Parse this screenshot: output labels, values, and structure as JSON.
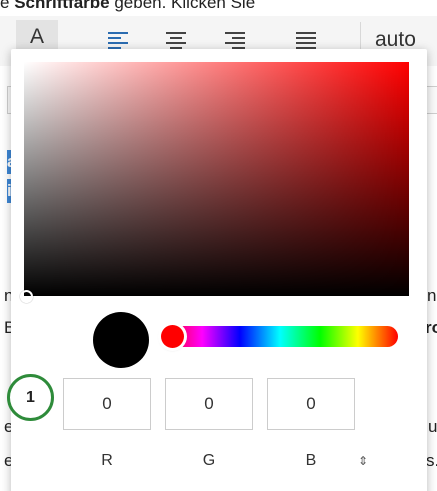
{
  "instruction": {
    "prefix": "e ",
    "bold": "Schriftfarbe",
    "suffix": " geben. Klicken Sie"
  },
  "toolbar": {
    "font_color_glyph": "A",
    "font_size_value": "auto"
  },
  "background_fragments": {
    "sel1": "ar",
    "sel2": "ir",
    "left1": "ne",
    "left2": "B",
    "left3": "e",
    "left4": "er",
    "right1": "n",
    "right2": "ro",
    "right3": "u",
    "right4": "s."
  },
  "color_picker": {
    "current_color": "#000000",
    "hue_color": "#ff0000",
    "channels": [
      {
        "label": "R",
        "value": "0"
      },
      {
        "label": "G",
        "value": "0"
      },
      {
        "label": "B",
        "value": "0"
      }
    ],
    "mode_toggle_glyph": "⇕"
  },
  "step_marker": {
    "number": "1",
    "color": "#2e8b3a"
  }
}
